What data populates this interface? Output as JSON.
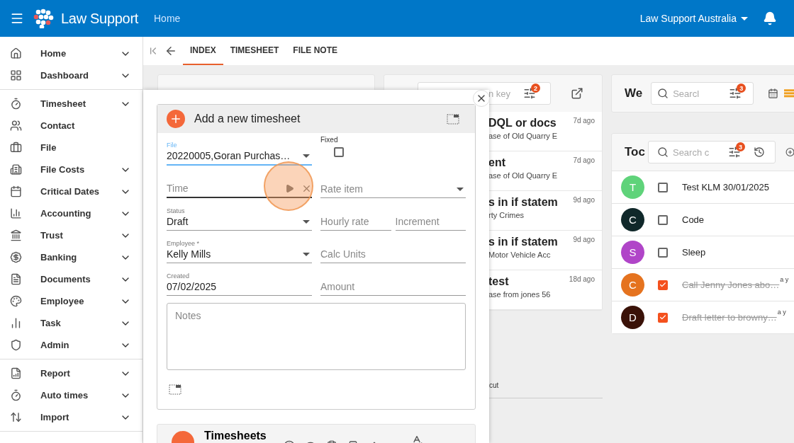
{
  "header": {
    "app_name": "Law Support",
    "breadcrumb": "Home",
    "organization": "Law Support Australia"
  },
  "sidebar": {
    "groups": [
      [
        {
          "label": "Home",
          "expandable": true
        },
        {
          "label": "Dashboard",
          "expandable": true
        }
      ],
      [
        {
          "label": "Timesheet",
          "expandable": true
        },
        {
          "label": "Contact",
          "expandable": false
        },
        {
          "label": "File",
          "expandable": false
        },
        {
          "label": "File Costs",
          "expandable": true
        },
        {
          "label": "Critical Dates",
          "expandable": true
        },
        {
          "label": "Accounting",
          "expandable": true
        },
        {
          "label": "Trust",
          "expandable": true
        },
        {
          "label": "Banking",
          "expandable": true
        },
        {
          "label": "Documents",
          "expandable": true
        },
        {
          "label": "Employee",
          "expandable": true
        },
        {
          "label": "Task",
          "expandable": true
        },
        {
          "label": "Admin",
          "expandable": true
        }
      ],
      [
        {
          "label": "Report",
          "expandable": true
        },
        {
          "label": "Auto times",
          "expandable": true
        },
        {
          "label": "Import",
          "expandable": true
        }
      ]
    ]
  },
  "tabs": [
    {
      "label": "INDEX",
      "selected": true
    },
    {
      "label": "TIMESHEET",
      "selected": false
    },
    {
      "label": "FILE NOTE",
      "selected": false
    }
  ],
  "documents_panel": {
    "search_placeholder": "n key",
    "filter_count": "2",
    "items": [
      {
        "title": "DQL or docs",
        "subtitle": "ase of Old Quarry E",
        "time": "7d ago"
      },
      {
        "title": "ent",
        "subtitle": "ase of Old Quarry E",
        "time": "7d ago"
      },
      {
        "title": "s in if statem",
        "subtitle": "rty Crimes",
        "time": "9d ago"
      },
      {
        "title": "s in if statem",
        "subtitle": "Motor Vehicle Acc",
        "time": "9d ago"
      },
      {
        "title": "test",
        "subtitle": "ase from jones 56",
        "time": "18d ago"
      }
    ],
    "footer_text": "cut"
  },
  "week_panel": {
    "title": "We",
    "search_placeholder": "Searcl",
    "filter_count": "3"
  },
  "todo_panel": {
    "title": "Toc",
    "search_placeholder": "Search c",
    "filter_count": "3",
    "items": [
      {
        "initial": "T",
        "color": "#5fd37a",
        "text": "Test KLM 30/01/2025",
        "checked": false
      },
      {
        "initial": "C",
        "color": "#10282a",
        "text": "Code",
        "checked": false
      },
      {
        "initial": "S",
        "color": "#b045c8",
        "text": "Sleep",
        "checked": false
      },
      {
        "initial": "C",
        "color": "#e5731f",
        "text": "Call Jenny Jones abo…",
        "checked": true,
        "time": "a y"
      },
      {
        "initial": "D",
        "color": "#3a1208",
        "text": "Draft letter to browny…",
        "checked": true,
        "time": "a y"
      }
    ]
  },
  "dialog": {
    "title": "Add a new timesheet",
    "rows": [
      [
        {
          "kind": "select",
          "label": "File",
          "value": "20220005,Goran Purchas…",
          "focused": true
        },
        {
          "kind": "checkbox",
          "label": "Fixed",
          "checked": false
        }
      ],
      [
        {
          "kind": "timer",
          "placeholder": "Time"
        },
        {
          "kind": "select",
          "placeholder": "Rate item"
        }
      ],
      [
        {
          "kind": "select",
          "label": "Status",
          "value": "Draft"
        },
        {
          "kind": "text",
          "placeholder": "Hourly rate"
        },
        {
          "kind": "text",
          "placeholder": "Increment"
        }
      ],
      [
        {
          "kind": "select",
          "label": "Employee *",
          "value": "Kelly Mills"
        },
        {
          "kind": "text",
          "placeholder": "Calc Units"
        }
      ],
      [
        {
          "kind": "text",
          "label": "Created",
          "value": "07/02/2025"
        },
        {
          "kind": "text",
          "placeholder": "Amount"
        }
      ]
    ],
    "notes_placeholder": "Notes"
  },
  "timesheets_card": {
    "title": "Timesheets"
  }
}
